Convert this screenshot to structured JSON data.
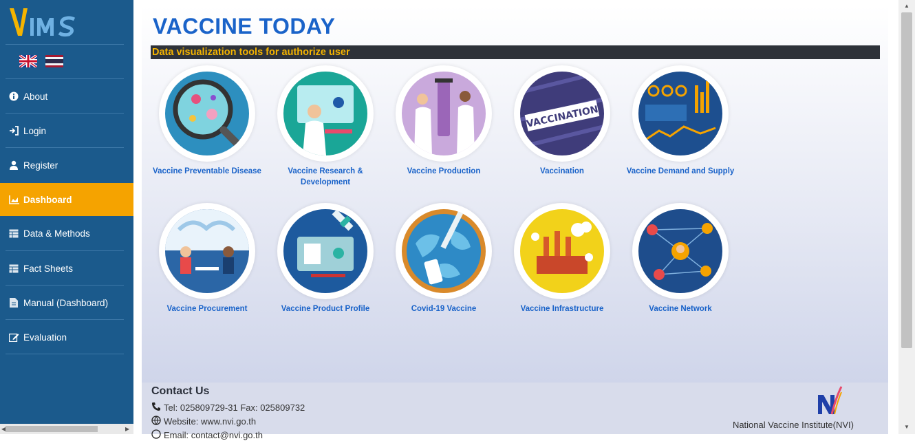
{
  "app": {
    "logo_text": "VIMS"
  },
  "colors": {
    "sidebar": "#1b5a8c",
    "accent": "#f5a300",
    "brand_blue": "#1a63c9"
  },
  "sidebar": {
    "languages": [
      "uk-flag-icon",
      "thai-flag-icon"
    ],
    "items": [
      {
        "label": "About",
        "icon": "info-icon"
      },
      {
        "label": "Login",
        "icon": "login-icon"
      },
      {
        "label": "Register",
        "icon": "user-icon"
      },
      {
        "label": "Dashboard",
        "icon": "chart-icon",
        "active": true
      },
      {
        "label": "Data & Methods",
        "icon": "table-icon"
      },
      {
        "label": "Fact Sheets",
        "icon": "table-icon"
      },
      {
        "label": "Manual (Dashboard)",
        "icon": "file-icon"
      },
      {
        "label": "Evaluation",
        "icon": "edit-icon"
      }
    ]
  },
  "main": {
    "title": "VACCINE TODAY",
    "subtitle": "Data visualization tools for authorize user",
    "tiles": [
      {
        "label": "Vaccine Preventable Disease"
      },
      {
        "label": "Vaccine Research & Development"
      },
      {
        "label": "Vaccine Production"
      },
      {
        "label": "Vaccination"
      },
      {
        "label": "Vaccine Demand and Supply"
      },
      {
        "label": "Vaccine Procurement"
      },
      {
        "label": "Vaccine Product Profile"
      },
      {
        "label": "Covid-19 Vaccine"
      },
      {
        "label": "Vaccine Infrastructure"
      },
      {
        "label": "Vaccine Network"
      }
    ]
  },
  "footer": {
    "title": "Contact Us",
    "tel": "Tel: 025809729-31 Fax: 025809732",
    "website": "Website: www.nvi.go.th",
    "email": "Email: contact@nvi.go.th",
    "org": "National Vaccine Institute(NVI)"
  }
}
